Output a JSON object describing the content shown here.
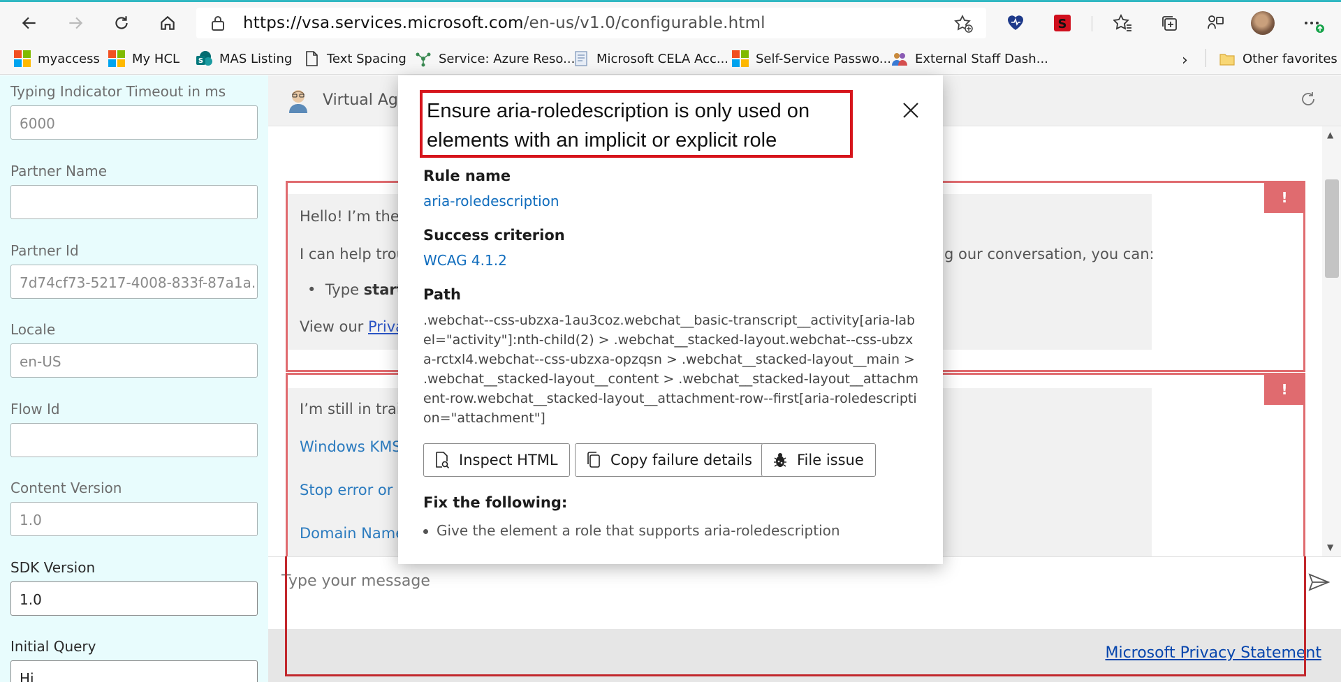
{
  "browser": {
    "url_prefix": "https://vsa.services.microsoft.com",
    "url_rest": "/en-us/v1.0/configurable.html"
  },
  "favorites": [
    {
      "label": "myaccess",
      "icon": "microsoft-logo-icon"
    },
    {
      "label": "My HCL",
      "icon": "microsoft-logo-icon"
    },
    {
      "label": "MAS Listing",
      "icon": "sharepoint-icon"
    },
    {
      "label": "Text Spacing",
      "icon": "page-icon"
    },
    {
      "label": "Service: Azure Reso...",
      "icon": "azure-service-icon"
    },
    {
      "label": "Microsoft CELA Acc...",
      "icon": "document-icon"
    },
    {
      "label": "Self-Service Passwo...",
      "icon": "microsoft-logo-icon"
    },
    {
      "label": "External Staff Dash...",
      "icon": "people-icon"
    }
  ],
  "other_favorites": "Other favorites",
  "left_panel": {
    "fields": [
      {
        "label": "Typing Indicator Timeout in ms",
        "value": "6000"
      },
      {
        "label": "Partner Name",
        "value": ""
      },
      {
        "label": "Partner Id",
        "value": "7d74cf73-5217-4008-833f-87a1a..."
      },
      {
        "label": "Locale",
        "value": "en-US"
      },
      {
        "label": "Flow Id",
        "value": ""
      },
      {
        "label": "Content Version",
        "value": "1.0"
      },
      {
        "label": "SDK Version",
        "value": "1.0"
      },
      {
        "label": "Initial Query",
        "value": "Hi"
      }
    ]
  },
  "chat": {
    "title": "Virtual Agent",
    "message1": {
      "line1": "Hello! I’m the",
      "line2_start": "I can help trou",
      "line2_end": "g our conversation, you can:",
      "bullet_prefix": "Type ",
      "bullet_bold": "start",
      "view_prefix": "View our ",
      "view_link": "Priva"
    },
    "message2": {
      "line1": "I’m still in train",
      "links": [
        "Windows KMS",
        "Stop error or b",
        "Domain Name"
      ]
    },
    "error_badge": "!",
    "composer_placeholder": "Type your message",
    "footer_link": "Microsoft Privacy Statement"
  },
  "modal": {
    "title": "Ensure aria-roledescription is only used on elements with an implicit or explicit role",
    "rule_name_label": "Rule name",
    "rule_name": "aria-roledescription",
    "success_label": "Success criterion",
    "success": "WCAG 4.1.2",
    "path_label": "Path",
    "path": ".webchat--css-ubzxa-1au3coz.webchat__basic-transcript__activity[aria-label=\"activity\"]:nth-child(2) > .webchat__stacked-layout.webchat--css-ubzxa-rctxl4.webchat--css-ubzxa-opzqsn > .webchat__stacked-layout__main > .webchat__stacked-layout__content > .webchat__stacked-layout__attachment-row.webchat__stacked-layout__attachment-row--first[aria-roledescription=\"attachment\"]",
    "buttons": {
      "inspect": "Inspect HTML",
      "copy": "Copy failure details",
      "file": "File issue"
    },
    "fix_label": "Fix the following:",
    "fix_item": "Give the element a role that supports aria-roledescription"
  },
  "colors": {
    "left_panel_bg": "#e8fcfd",
    "error_red": "#e06b6f",
    "highlight_red": "#d6151c",
    "link_blue": "#0f6cbd"
  }
}
